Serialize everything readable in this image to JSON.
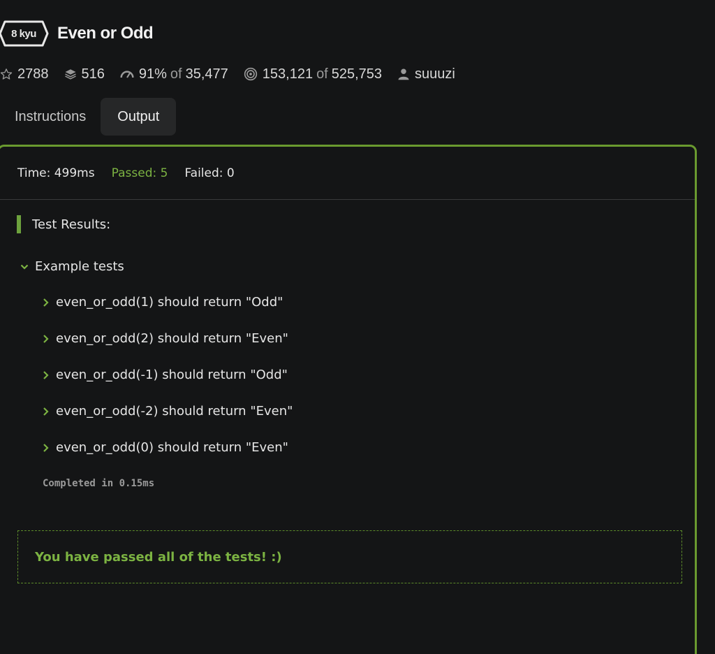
{
  "header": {
    "rank": "8 kyu",
    "title": "Even or Odd"
  },
  "stats": {
    "stars": "2788",
    "collections": "516",
    "satisfaction_percent": "91%",
    "satisfaction_of": "of",
    "satisfaction_votes": "35,477",
    "completed": "153,121",
    "completed_of": "of",
    "attempted": "525,753",
    "author": "suuuzi"
  },
  "tabs": [
    {
      "label": "Instructions",
      "active": false
    },
    {
      "label": "Output",
      "active": true
    }
  ],
  "output": {
    "time": "Time: 499ms",
    "passed": "Passed: 5",
    "failed": "Failed: 0",
    "results_heading": "Test Results:",
    "group_label": "Example tests",
    "tests": [
      "even_or_odd(1) should return \"Odd\"",
      "even_or_odd(2) should return \"Even\"",
      "even_or_odd(-1) should return \"Odd\"",
      "even_or_odd(-2) should return \"Even\"",
      "even_or_odd(0) should return \"Even\""
    ],
    "completed": "Completed in 0.15ms",
    "pass_message": "You have passed all of the tests! :)"
  },
  "colors": {
    "background": "#141516",
    "accent_green": "#7cb342",
    "panel_border": "#6a9a2f",
    "active_tab": "#262728"
  },
  "icons": {
    "stars": "star-icon",
    "collections": "layers-icon",
    "satisfaction": "gauge-icon",
    "completed": "target-icon",
    "author": "user-icon",
    "expand": "chevron-right-icon",
    "collapse": "chevron-down-icon"
  }
}
